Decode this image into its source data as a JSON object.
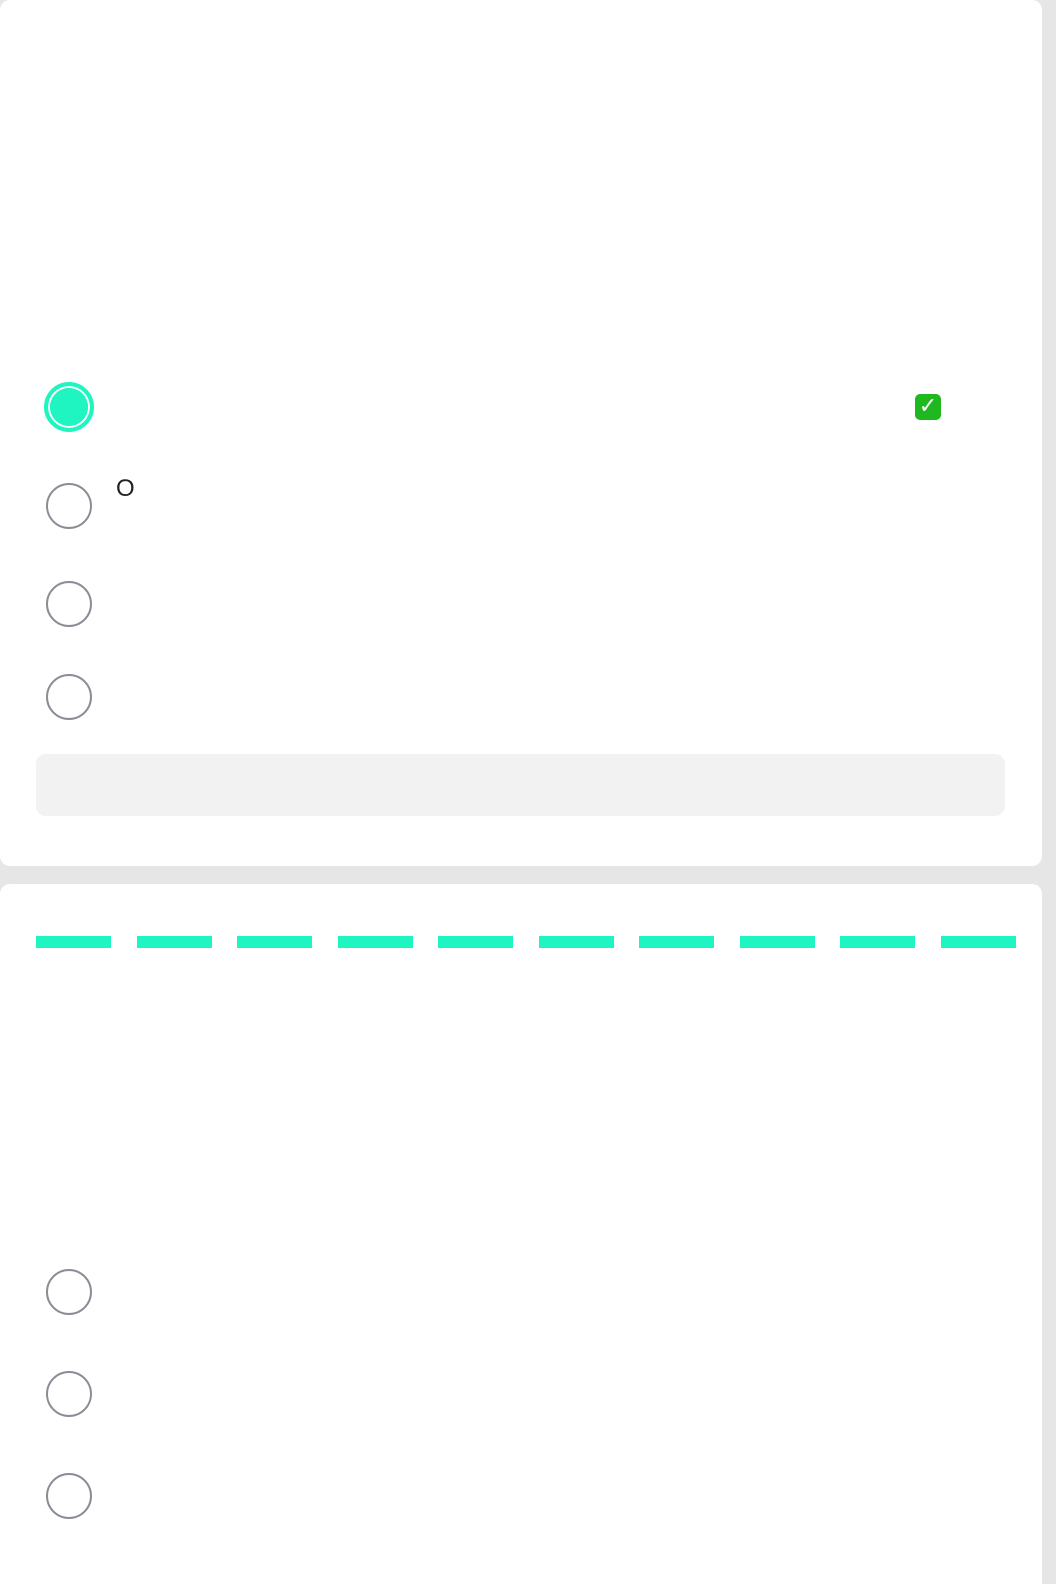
{
  "colors": {
    "accent": "#1ef5c0",
    "correct": "#1fb81f",
    "radio_border": "#8c8c96",
    "feedback_bg": "#f2f2f2"
  },
  "question_1": {
    "options": [
      {
        "label": "",
        "selected": true
      },
      {
        "label": "O",
        "selected": false
      },
      {
        "label": "",
        "selected": false
      },
      {
        "label": "",
        "selected": false
      }
    ],
    "correct_icon": "check-mark-icon",
    "feedback_text": ""
  },
  "question_2": {
    "progress": {
      "segments": 10,
      "filled": 10
    },
    "options": [
      {
        "label": "",
        "selected": false
      },
      {
        "label": "",
        "selected": false
      },
      {
        "label": "",
        "selected": false
      }
    ]
  }
}
